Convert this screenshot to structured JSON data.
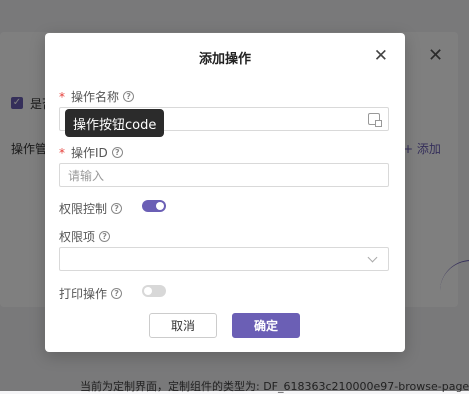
{
  "background": {
    "checkbox_label": "是否",
    "section_label": "操作管",
    "add_link": "+ 添加",
    "bottom_text": "当前为定制界面，定制组件的类型为: DF_618363c210000e97-browse-page",
    "accent_color": "#6b5fb5"
  },
  "modal": {
    "title": "添加操作",
    "close_icon": "close-icon",
    "fields": {
      "name": {
        "label": "操作名称",
        "required": "*",
        "value": "",
        "tooltip": "操作按钮code",
        "icon": "translate-icon"
      },
      "id": {
        "label": "操作ID",
        "required": "*",
        "placeholder": "请输入"
      },
      "permission_control": {
        "label": "权限控制",
        "enabled": true
      },
      "permission_item": {
        "label": "权限项",
        "value": ""
      },
      "print_operation": {
        "label": "打印操作",
        "enabled": false
      }
    },
    "buttons": {
      "cancel": "取消",
      "confirm": "确定"
    }
  }
}
